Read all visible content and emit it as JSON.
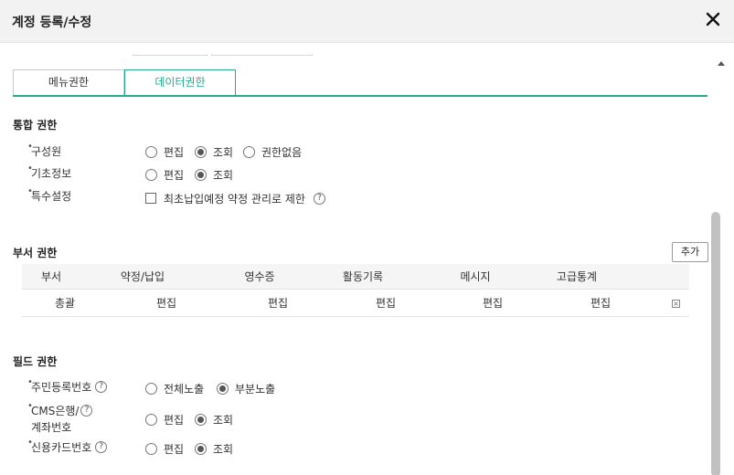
{
  "dialog": {
    "title": "계정 등록/수정"
  },
  "tabs": [
    {
      "label": "메뉴권한",
      "active": false
    },
    {
      "label": "데이터권한",
      "active": true
    }
  ],
  "integrated": {
    "title": "통합 권한",
    "rows": [
      {
        "label": "구성원",
        "options": [
          "편집",
          "조회",
          "권한없음"
        ],
        "selected": "조회"
      },
      {
        "label": "기초정보",
        "options": [
          "편집",
          "조회"
        ],
        "selected": "조회"
      },
      {
        "label": "특수설정",
        "checkbox_label": "최초납입예정 약정 관리로 제한",
        "checked": false
      }
    ]
  },
  "department": {
    "title": "부서 권한",
    "add_label": "추가",
    "columns": [
      "부서",
      "약정/납입",
      "영수증",
      "활동기록",
      "메시지",
      "고급통계"
    ],
    "rows": [
      {
        "cells": [
          "총괄",
          "편집",
          "편집",
          "편집",
          "편집",
          "편집"
        ]
      }
    ]
  },
  "field": {
    "title": "필드 권한",
    "rows": [
      {
        "label": "주민등록번호",
        "options": [
          "전체노출",
          "부분노출"
        ],
        "selected": "부분노출",
        "help": true
      },
      {
        "label_line1": "CMS은행/",
        "label_line2": "계좌번호",
        "options": [
          "편집",
          "조회"
        ],
        "selected": "조회",
        "help": true
      },
      {
        "label": "신용카드번호",
        "options": [
          "편집",
          "조회"
        ],
        "selected": "조회",
        "help": true
      }
    ]
  },
  "icons": {
    "help": "?",
    "close": "close-icon",
    "delete": "×"
  },
  "colors": {
    "accent": "#2aa889"
  }
}
